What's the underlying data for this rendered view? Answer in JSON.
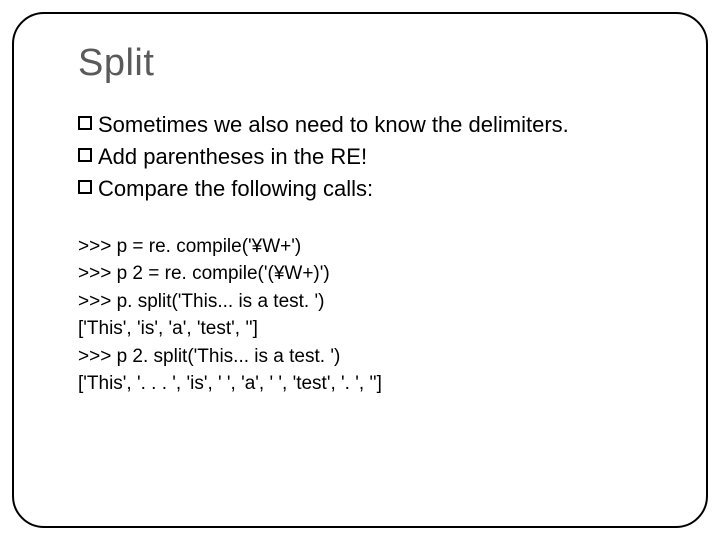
{
  "title": "Split",
  "bullets": [
    "Sometimes we also need to know the delimiters.",
    "Add parentheses in the RE!",
    "Compare the following calls:"
  ],
  "code": [
    ">>> p = re. compile('¥W+')",
    ">>> p 2 = re. compile('(¥W+)')",
    ">>> p. split('This... is a test. ')",
    "['This', 'is', 'a', 'test', '']",
    ">>> p 2. split('This... is a test. ')",
    "['This', '. . . ', 'is', ' ', 'a', ' ', 'test', '. ', '']"
  ]
}
